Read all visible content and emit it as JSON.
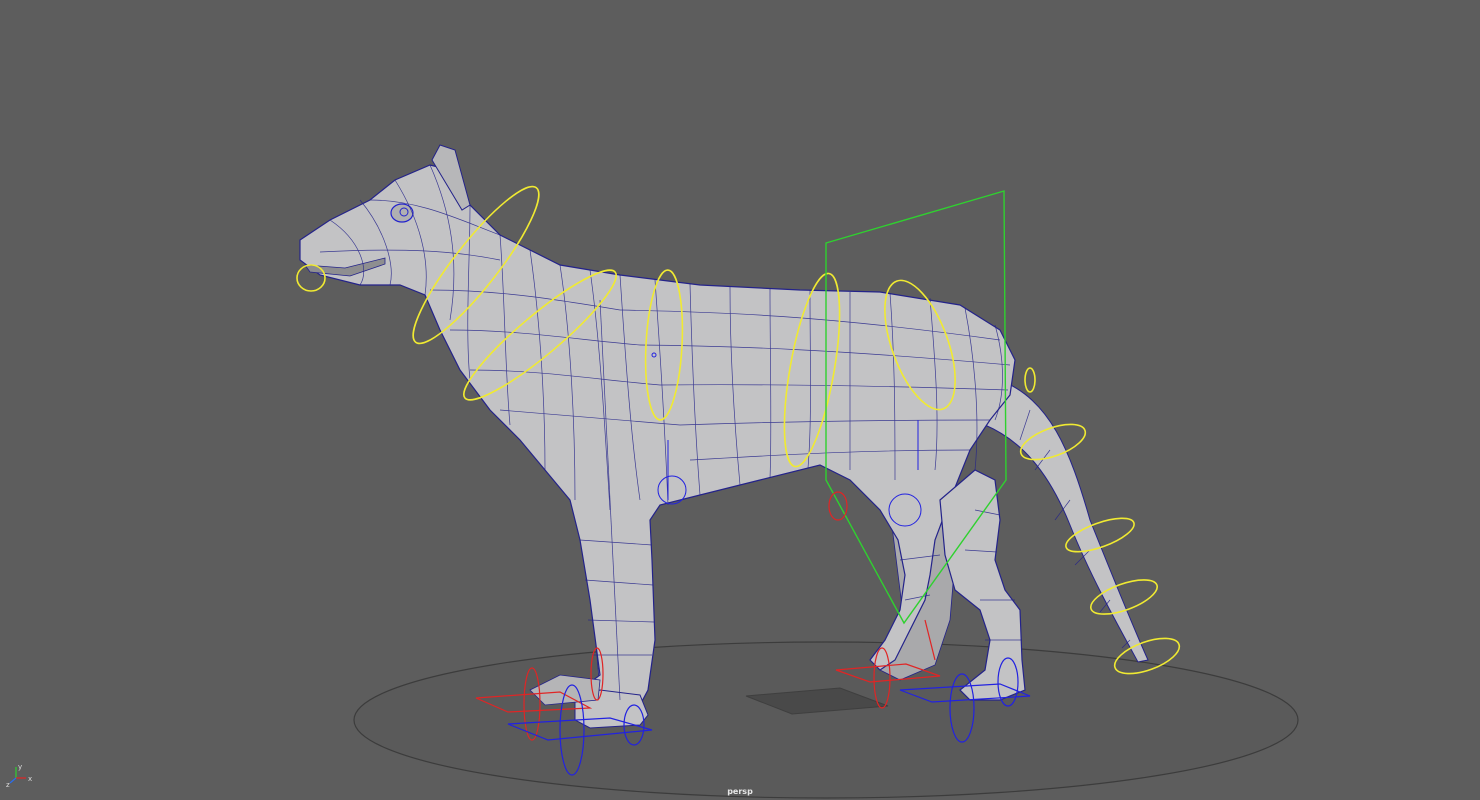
{
  "viewport": {
    "camera_name": "persp",
    "background_color": "#5d5d5d"
  },
  "axis_indicator": {
    "labels": [
      "y",
      "x",
      "z"
    ]
  },
  "colors": {
    "mesh_fill": "#c3c3c5",
    "wireframe": "#24238a",
    "fk_controls": "#f0ea32",
    "root_control": "#2fd12f",
    "ik_left": "#e02525",
    "ik_right": "#2222e0",
    "ground_circle": "#3c3c3c"
  },
  "scene": {
    "object": "quadruped-rig",
    "controls": [
      "jaw-control",
      "neck-control",
      "chest-control",
      "spine-control-1",
      "spine-control-2",
      "hip-control",
      "tail-control-1",
      "tail-control-2",
      "tail-control-3",
      "tail-control-4",
      "tail-control-5",
      "root-control",
      "front-foot-ik-left",
      "front-foot-ik-right",
      "hind-foot-ik-left",
      "hind-foot-ik-right"
    ]
  }
}
